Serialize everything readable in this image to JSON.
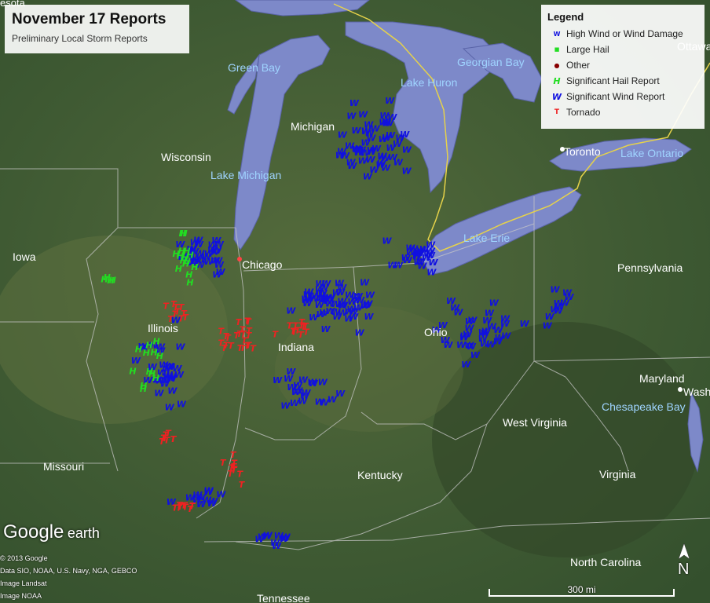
{
  "header": {
    "title": "November 17 Reports",
    "subtitle": "Preliminary Local Storm Reports"
  },
  "legend": {
    "title": "Legend",
    "items": [
      {
        "label": "High Wind or Wind Damage",
        "symbol": "W",
        "color": "#1010e0"
      },
      {
        "label": "Large Hail",
        "symbol": "■",
        "color": "#22dd22"
      },
      {
        "label": "Other",
        "symbol": "●",
        "color": "#880000"
      },
      {
        "label": "Significant Hail Report",
        "symbol": "H",
        "color": "#22dd22"
      },
      {
        "label": "Significant Wind Report",
        "symbol": "W",
        "color": "#1010e0"
      },
      {
        "label": "Tornado",
        "symbol": "T",
        "color": "#ee2222"
      }
    ]
  },
  "place_labels": [
    {
      "text": "Green Bay",
      "kind": "water"
    },
    {
      "text": "Lake Huron",
      "kind": "water"
    },
    {
      "text": "Georgian Bay",
      "kind": "water"
    },
    {
      "text": "Lake Michigan",
      "kind": "water"
    },
    {
      "text": "Lake Erie",
      "kind": "water"
    },
    {
      "text": "Lake Ontario",
      "kind": "water"
    },
    {
      "text": "Chesapeake Bay",
      "kind": "water"
    },
    {
      "text": "Ottawa",
      "kind": "city"
    },
    {
      "text": "Toronto",
      "kind": "city"
    },
    {
      "text": "Chicago",
      "kind": "city"
    },
    {
      "text": "Wash",
      "kind": "city"
    },
    {
      "text": "esota",
      "kind": "state"
    },
    {
      "text": "Michigan",
      "kind": "state"
    },
    {
      "text": "Wisconsin",
      "kind": "state"
    },
    {
      "text": "Iowa",
      "kind": "state"
    },
    {
      "text": "Illinois",
      "kind": "state"
    },
    {
      "text": "Indiana",
      "kind": "state"
    },
    {
      "text": "Ohio",
      "kind": "state"
    },
    {
      "text": "Pennsylvania",
      "kind": "state"
    },
    {
      "text": "Maryland",
      "kind": "state"
    },
    {
      "text": "West Virginia",
      "kind": "state"
    },
    {
      "text": "Missouri",
      "kind": "state"
    },
    {
      "text": "Kentucky",
      "kind": "state"
    },
    {
      "text": "Virginia",
      "kind": "state"
    },
    {
      "text": "North Carolina",
      "kind": "state"
    },
    {
      "text": "Tennessee",
      "kind": "state"
    }
  ],
  "branding": {
    "google": "Google",
    "earth": "earth"
  },
  "attribution": [
    "© 2013 Google",
    "Data SIO, NOAA, U.S. Navy, NGA, GEBCO",
    "Image Landsat",
    "Image NOAA"
  ],
  "scale": {
    "label": "300 mi"
  },
  "compass": {
    "label": "N"
  },
  "colors": {
    "land": "#3f5a33",
    "water": "#7d89c9",
    "border": "#c8c8c8",
    "intl_border": "#e6d24a",
    "wind": "#1010e0",
    "hail": "#22dd22",
    "tornado": "#ee2222"
  }
}
